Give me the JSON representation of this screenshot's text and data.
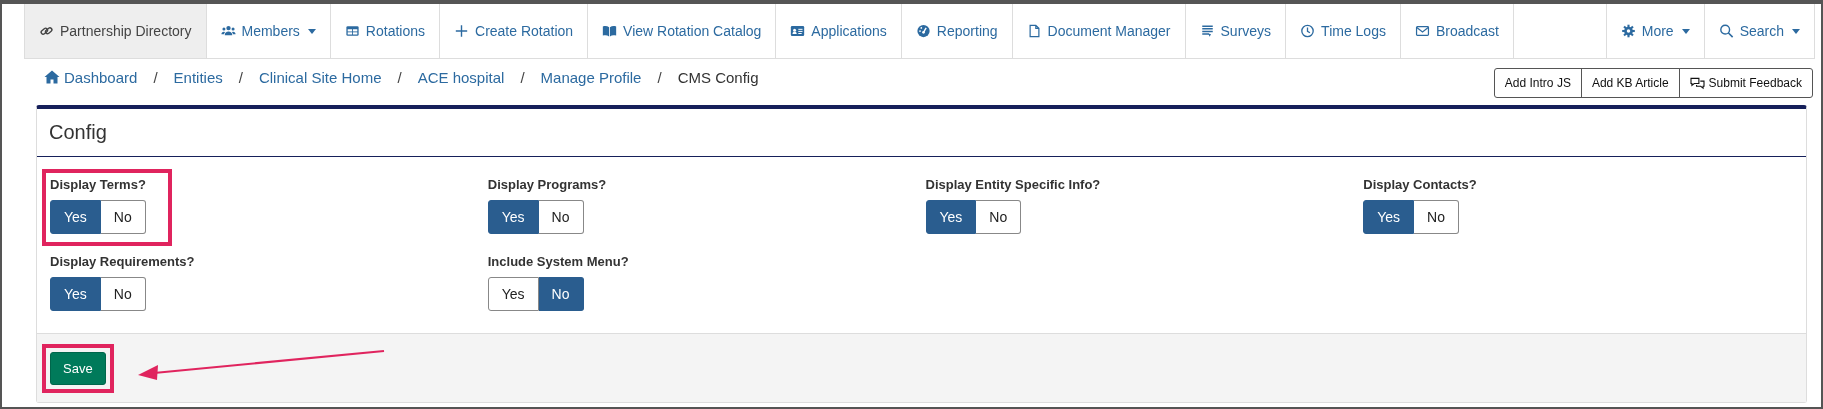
{
  "nav": [
    {
      "label": "Partnership Directory",
      "selected": true,
      "dropdown": false
    },
    {
      "label": "Members",
      "selected": false,
      "dropdown": true
    },
    {
      "label": "Rotations",
      "selected": false,
      "dropdown": false
    },
    {
      "label": "Create Rotation",
      "selected": false,
      "dropdown": false
    },
    {
      "label": "View Rotation Catalog",
      "selected": false,
      "dropdown": false
    },
    {
      "label": "Applications",
      "selected": false,
      "dropdown": false
    },
    {
      "label": "Reporting",
      "selected": false,
      "dropdown": false
    },
    {
      "label": "Document Manager",
      "selected": false,
      "dropdown": false
    },
    {
      "label": "Surveys",
      "selected": false,
      "dropdown": false
    },
    {
      "label": "Time Logs",
      "selected": false,
      "dropdown": false
    },
    {
      "label": "Broadcast",
      "selected": false,
      "dropdown": false
    }
  ],
  "nav_right": [
    {
      "label": "More",
      "selected": false,
      "dropdown": true
    },
    {
      "label": "Search",
      "selected": false,
      "dropdown": true
    }
  ],
  "breadcrumb": [
    "Dashboard",
    "Entities",
    "Clinical Site Home",
    "ACE hospital",
    "Manage Profile",
    "CMS Config"
  ],
  "breadcrumb_separators": [
    "/",
    "/",
    "/",
    "/",
    "/"
  ],
  "actions": [
    "Add Intro JS",
    "Add KB Article",
    "Submit Feedback"
  ],
  "panel": {
    "title": "Config",
    "fields": [
      {
        "label": "Display Terms?",
        "options": [
          {
            "label": "Yes",
            "selected": true
          },
          {
            "label": "No",
            "selected": false
          }
        ],
        "highlighted": true
      },
      {
        "label": "Display Programs?",
        "options": [
          {
            "label": "Yes",
            "selected": true
          },
          {
            "label": "No",
            "selected": false
          }
        ],
        "highlighted": false
      },
      {
        "label": "Display Entity Specific Info?",
        "options": [
          {
            "label": "Yes",
            "selected": true
          },
          {
            "label": "No",
            "selected": false
          }
        ],
        "highlighted": false
      },
      {
        "label": "Display Contacts?",
        "options": [
          {
            "label": "Yes",
            "selected": true
          },
          {
            "label": "No",
            "selected": false
          }
        ],
        "highlighted": false
      },
      {
        "label": "Display Requirements?",
        "options": [
          {
            "label": "Yes",
            "selected": true
          },
          {
            "label": "No",
            "selected": false
          }
        ],
        "highlighted": false
      },
      {
        "label": "Include System Menu?",
        "options": [
          {
            "label": "Yes",
            "selected": false
          },
          {
            "label": "No",
            "selected": true
          }
        ],
        "highlighted": false
      }
    ],
    "save": {
      "label": "Save",
      "highlighted": true,
      "arrow": true
    }
  }
}
